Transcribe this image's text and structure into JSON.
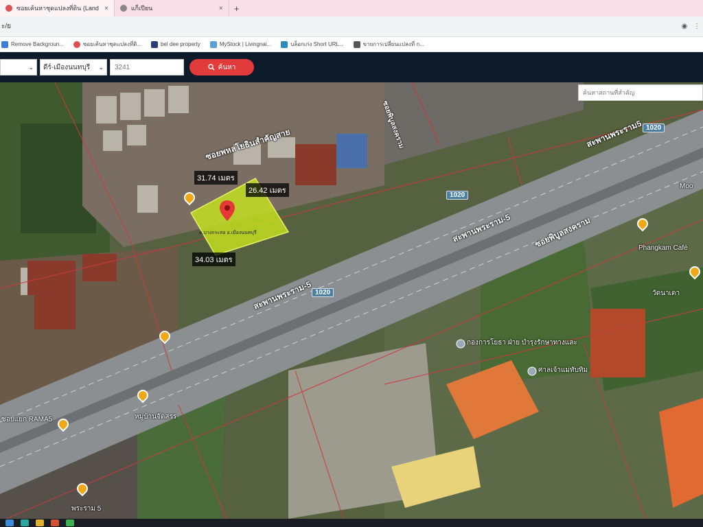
{
  "browser": {
    "tabs": [
      {
        "label": "ซอยเค้นหาชุดแปลงที่ดิน (LandsMa...",
        "close": "×",
        "active": true
      },
      {
        "label": "แก็เปียน",
        "close": "×",
        "active": false
      }
    ],
    "new_tab": "+",
    "url_text": "ะ/ย",
    "location_icon": "location-pin-icon",
    "menu_icon": "kebab-menu-icon"
  },
  "bookmarks": [
    {
      "label": "Remove Backgroun..."
    },
    {
      "label": "ซอยเค้นหาชุดแปลงที่ดิ..."
    },
    {
      "label": "bel dee property"
    },
    {
      "label": "MyStock | Livingnai..."
    },
    {
      "label": "บล็อกเก่ง Short URL..."
    },
    {
      "label": "ขายการเปลี่ยนแปลงที่ ก..."
    }
  ],
  "searchbar": {
    "province_value": "",
    "district_value": "ดีร์-เมืองนนทบุรี",
    "code_placeholder": "3241",
    "search_label": "ค้นหา"
  },
  "map": {
    "search_placeholder": "ค้นหาสถานที่สำคัญ",
    "measurements": {
      "top": "31.74 เมตร",
      "right": "26.42 เมตร",
      "bottom": "34.03 เมตร"
    },
    "plot_caption": "ต.บางกระสอ อ.เมืองนนทบุรี",
    "roads": {
      "upper_left": "ซอยพหลโยธินสำคัญสาย",
      "upper_right": "สะพานพระราม5",
      "middle": "สะพานพระราม-5",
      "lower": "สะพานพระราม-5",
      "soi": "ซอยพิบูลสงคราม",
      "vertical": "ซอยพิบูลสงคราม"
    },
    "route_shields": [
      "1020",
      "1020",
      "1020"
    ],
    "pois": [
      {
        "label": "กองการโยธา ฝ่าย บำรุงรักษาทางและ"
      },
      {
        "label": "ศาลเจ้าแม่ทับทิม"
      },
      {
        "label": "ซอยแยก RAMA5"
      },
      {
        "label": "หมู่บ้านจัดสรร"
      },
      {
        "label": "พระราม 5"
      },
      {
        "label": "Phangkam Café"
      },
      {
        "label": "Moo"
      },
      {
        "label": "วัดนาเดา"
      }
    ],
    "colors": {
      "plot_fill": "#c8e61e",
      "parcel_line": "#c83c3c",
      "marker": "#e53935",
      "poi_pin": "#f0a818",
      "app_bar": "#0d1b2a"
    }
  }
}
